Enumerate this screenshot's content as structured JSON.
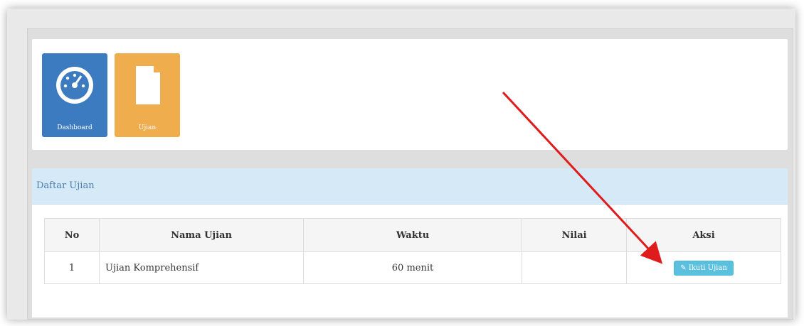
{
  "tiles": [
    {
      "label": "Dashboard",
      "icon": "gauge-icon"
    },
    {
      "label": "Ujian",
      "icon": "document-icon"
    }
  ],
  "panel": {
    "title": "Daftar Ujian"
  },
  "table": {
    "headers": [
      "No",
      "Nama Ujian",
      "Waktu",
      "Nilai",
      "Aksi"
    ],
    "rows": [
      {
        "no": "1",
        "nama": "Ujian Komprehensif",
        "waktu": "60 menit",
        "nilai": "",
        "aksi": "Ikuti Ujian"
      }
    ]
  },
  "colors": {
    "primary": "#3c7bc0",
    "warning": "#f0ad4e",
    "info": "#5bc0de",
    "panel_heading": "#d6e9f6",
    "annotation_arrow": "#e01b1b"
  }
}
